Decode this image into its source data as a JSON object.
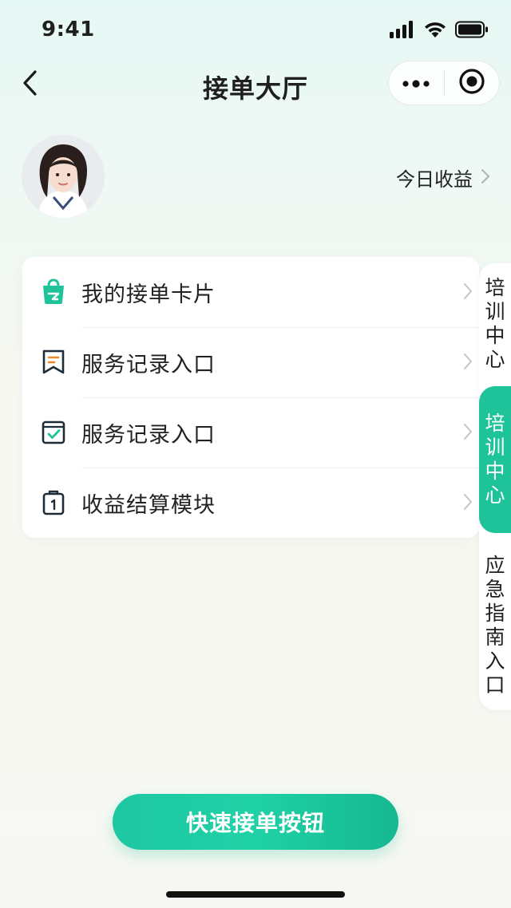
{
  "status_bar": {
    "time": "9:41",
    "icons": [
      "signal-icon",
      "wifi-icon",
      "battery-icon"
    ]
  },
  "nav": {
    "title": "接单大厅",
    "back_icon": "chevron-left-icon",
    "capsule_icons": [
      "more-dots-icon",
      "record-target-icon"
    ]
  },
  "profile": {
    "avatar": "avatar",
    "earnings_label": "今日收益",
    "earnings_icon": "chevron-right-icon"
  },
  "menu": {
    "items": [
      {
        "label": "我的接单卡片",
        "icon": "shopping-bag-icon"
      },
      {
        "label": "服务记录入口",
        "icon": "bookmark-list-icon"
      },
      {
        "label": "服务记录入口",
        "icon": "checked-calendar-icon"
      },
      {
        "label": "收益结算模块",
        "icon": "clipboard-one-icon"
      }
    ]
  },
  "side_tabs": [
    {
      "label": "培训中心",
      "active": false
    },
    {
      "label": "培训中心",
      "active": true
    },
    {
      "label": "应急指南入口",
      "active": false
    }
  ],
  "cta": {
    "label": "快速接单按钮"
  },
  "colors": {
    "accent": "#1fc39a",
    "icon_orange": "#f28a2c",
    "text": "#1f1f1f",
    "bg_top": "#e6f8f4"
  }
}
